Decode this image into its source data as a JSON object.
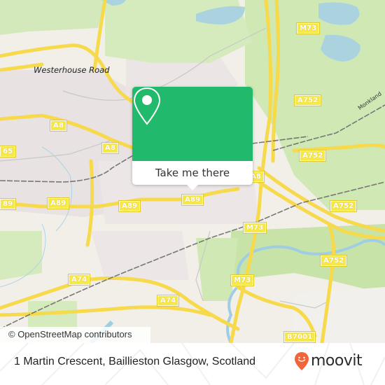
{
  "map": {
    "place_labels": [
      {
        "id": "westerhouse-road",
        "text": "Westerhouse Road"
      }
    ],
    "rail_labels": [
      {
        "id": "monkland",
        "text": "Monkland"
      }
    ],
    "road_labels": [
      {
        "id": "m73-north",
        "text": "M73"
      },
      {
        "id": "a752-north",
        "text": "A752"
      },
      {
        "id": "a8-west",
        "text": "A8"
      },
      {
        "id": "a8-center",
        "text": "A8"
      },
      {
        "id": "a8-popup",
        "text": "A8"
      },
      {
        "id": "a65-left",
        "text": "65"
      },
      {
        "id": "a752-east",
        "text": "A752"
      },
      {
        "id": "a89-left",
        "text": "89"
      },
      {
        "id": "a89-mid",
        "text": "A89"
      },
      {
        "id": "a89-center",
        "text": "A89"
      },
      {
        "id": "a89-right",
        "text": "A89"
      },
      {
        "id": "a752-se",
        "text": "A752"
      },
      {
        "id": "m73-mid",
        "text": "M73"
      },
      {
        "id": "a74-left",
        "text": "A74"
      },
      {
        "id": "a752-south",
        "text": "A752"
      },
      {
        "id": "m73-south",
        "text": "M73"
      },
      {
        "id": "a74-right",
        "text": "A74"
      },
      {
        "id": "b7001",
        "text": "B7001"
      }
    ],
    "attribution": "© OpenStreetMap contributors"
  },
  "popup": {
    "icon": "map-pin-icon",
    "action_label": "Take me there",
    "color": "#21b96b"
  },
  "footer": {
    "address": "1 Martin Crescent, Baillieston Glasgow, Scotland",
    "brand_name": "moovit",
    "brand_icon": "moovit-pin-icon",
    "brand_color": "#f2643a"
  }
}
